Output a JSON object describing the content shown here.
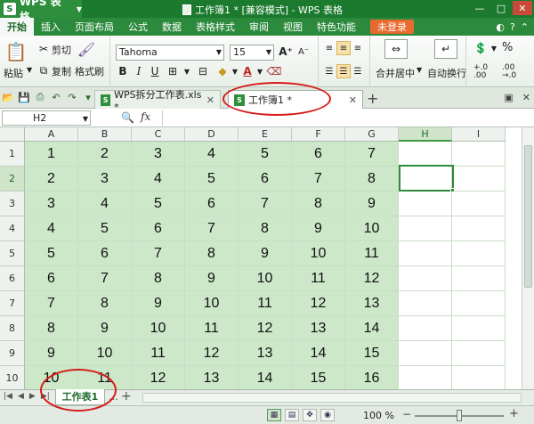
{
  "app": {
    "name": "WPS 表格",
    "logo": "S"
  },
  "window": {
    "title": "工作簿1 * [兼容模式] - WPS 表格"
  },
  "menu": {
    "tabs": [
      "开始",
      "插入",
      "页面布局",
      "公式",
      "数据",
      "表格样式",
      "审阅",
      "视图",
      "特色功能"
    ],
    "login": "未登录"
  },
  "ribbon": {
    "paste": "粘贴",
    "cut": "剪切",
    "copy": "复制",
    "format_painter": "格式刷",
    "font_name": "Tahoma",
    "font_size": "15",
    "merge_center": "合并居中",
    "wrap_text": "自动换行",
    "percent": "%",
    "decimal_inc": "+.0 .00",
    "decimal_dec": ".00 →.0"
  },
  "doc_tabs": {
    "inactive": "WPS拆分工作表.xls *",
    "active": "工作簿1 *",
    "new_tab": "+"
  },
  "formula_bar": {
    "cell_ref": "H2",
    "fx": "fx",
    "formula": ""
  },
  "grid": {
    "columns": [
      "A",
      "B",
      "C",
      "D",
      "E",
      "F",
      "G",
      "H",
      "I"
    ],
    "rows": [
      "1",
      "2",
      "3",
      "4",
      "5",
      "6",
      "7",
      "8",
      "9",
      "10"
    ],
    "selected": {
      "col": "H",
      "row": "2"
    },
    "cells": [
      [
        "1",
        "2",
        "3",
        "4",
        "5",
        "6",
        "7"
      ],
      [
        "2",
        "3",
        "4",
        "5",
        "6",
        "7",
        "8"
      ],
      [
        "3",
        "4",
        "5",
        "6",
        "7",
        "8",
        "9"
      ],
      [
        "4",
        "5",
        "6",
        "7",
        "8",
        "9",
        "10"
      ],
      [
        "5",
        "6",
        "7",
        "8",
        "9",
        "10",
        "11"
      ],
      [
        "6",
        "7",
        "8",
        "9",
        "10",
        "11",
        "12"
      ],
      [
        "7",
        "8",
        "9",
        "10",
        "11",
        "12",
        "13"
      ],
      [
        "8",
        "9",
        "10",
        "11",
        "12",
        "13",
        "14"
      ],
      [
        "9",
        "10",
        "11",
        "12",
        "13",
        "14",
        "15"
      ],
      [
        "10",
        "11",
        "12",
        "13",
        "14",
        "15",
        "16"
      ]
    ]
  },
  "sheet_tabs": {
    "active": "工作表1",
    "more": "…",
    "add": "+"
  },
  "status": {
    "zoom": "100 %",
    "zoom_level_percent": 50
  },
  "colors": {
    "brand": "#1c7a2e",
    "cell_fill": "#cce8c9",
    "annotation": "#d51a1a"
  }
}
